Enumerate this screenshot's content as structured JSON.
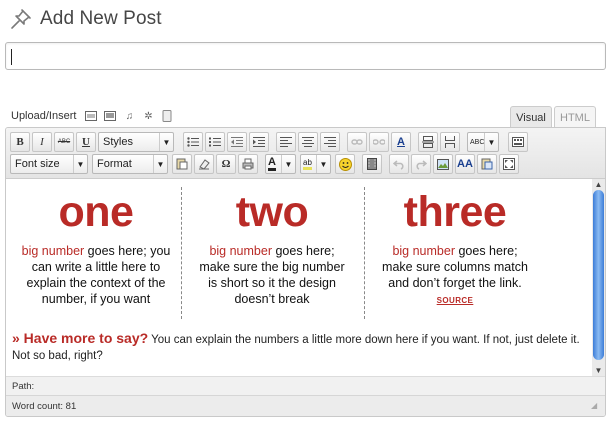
{
  "header": {
    "title": "Add New Post",
    "icon": "pushpin-icon"
  },
  "title_input": {
    "value": "",
    "placeholder": ""
  },
  "media": {
    "label": "Upload/Insert",
    "icons": [
      "image-icon",
      "video-icon",
      "audio-icon",
      "media-icon",
      "other-media-icon"
    ]
  },
  "tabs": {
    "visual": "Visual",
    "html": "HTML",
    "active": "Visual"
  },
  "toolbar": {
    "row1": {
      "bold": "B",
      "italic": "I",
      "strikethrough": "ABC",
      "underline": "U",
      "styles_select": "Styles",
      "spellcheck": "ABC"
    },
    "row2": {
      "font_size_select": "Font size",
      "format_select": "Format",
      "special_char": "Ω",
      "text_color": "A",
      "highlight": "ab"
    }
  },
  "content": {
    "columns": [
      {
        "number": "one",
        "highlight": "big number",
        "text": " goes here; you can write a little here to explain the context of the number, if you want",
        "link": ""
      },
      {
        "number": "two",
        "highlight": "big number",
        "text": " goes here; make sure the big number is short so it the design doesn’t break",
        "link": ""
      },
      {
        "number": "three",
        "highlight": "big number",
        "text": " goes here; make sure columns match and don’t forget the link. ",
        "link": "SOURCE"
      }
    ],
    "more": {
      "heading": "» Have more to say?",
      "text": " You can explain the numbers a little more down here if you want. If not, just delete it. Not so bad, right?"
    }
  },
  "status": {
    "path_label": "Path:",
    "word_count": "Word count: 81"
  },
  "colors": {
    "accent_red": "#b92b27",
    "scrollbar_blue": "#3d7dd8"
  }
}
